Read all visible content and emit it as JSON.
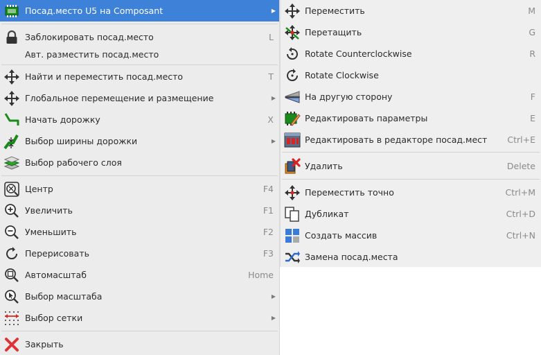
{
  "left_menu": {
    "items": [
      {
        "label": "Посад.место U5 на Composant",
        "shortcut": "",
        "submenu": true,
        "highlighted": true,
        "icon": "footprint-icon"
      },
      {
        "label": "Заблокировать посад.место",
        "shortcut": "L",
        "icon": "lock-icon"
      },
      {
        "label": "Авт. разместить посад.место",
        "shortcut": "",
        "icon": ""
      },
      {
        "label": "Найти и переместить посад.место",
        "shortcut": "T",
        "icon": "move-arrows-icon"
      },
      {
        "label": "Глобальное перемещение и размещение",
        "shortcut": "",
        "submenu": true,
        "icon": "move-arrows-icon"
      },
      {
        "label": "Начать дорожку",
        "shortcut": "X",
        "icon": "track-icon"
      },
      {
        "label": "Выбор ширины дорожки",
        "shortcut": "",
        "submenu": true,
        "icon": "track-width-icon"
      },
      {
        "label": "Выбор рабочего слоя",
        "shortcut": "",
        "icon": "layers-icon"
      },
      {
        "label": "Центр",
        "shortcut": "F4",
        "icon": "zoom-center-icon"
      },
      {
        "label": "Увеличить",
        "shortcut": "F1",
        "icon": "zoom-in-icon"
      },
      {
        "label": "Уменьшить",
        "shortcut": "F2",
        "icon": "zoom-out-icon"
      },
      {
        "label": "Перерисовать",
        "shortcut": "F3",
        "icon": "redraw-icon"
      },
      {
        "label": "Автомасштаб",
        "shortcut": "Home",
        "icon": "zoom-fit-icon"
      },
      {
        "label": "Выбор масштаба",
        "shortcut": "",
        "submenu": true,
        "icon": "zoom-select-icon"
      },
      {
        "label": "Выбор сетки",
        "shortcut": "",
        "submenu": true,
        "icon": "grid-icon"
      },
      {
        "label": "Закрыть",
        "shortcut": "",
        "icon": "close-icon"
      }
    ]
  },
  "right_menu": {
    "items": [
      {
        "label": "Переместить",
        "shortcut": "M",
        "icon": "move-arrows-icon"
      },
      {
        "label": "Перетащить",
        "shortcut": "G",
        "icon": "drag-icon"
      },
      {
        "label": "Rotate Counterclockwise",
        "shortcut": "R",
        "icon": "rotate-ccw-icon"
      },
      {
        "label": "Rotate Clockwise",
        "shortcut": "",
        "icon": "rotate-cw-icon"
      },
      {
        "label": "На другую сторону",
        "shortcut": "F",
        "icon": "flip-icon"
      },
      {
        "label": "Редактировать параметры",
        "shortcut": "E",
        "icon": "edit-properties-icon"
      },
      {
        "label": "Редактировать в редакторе посад.мест",
        "shortcut": "Ctrl+E",
        "icon": "footprint-editor-icon"
      },
      {
        "label": "Удалить",
        "shortcut": "Delete",
        "icon": "delete-icon"
      },
      {
        "label": "Переместить точно",
        "shortcut": "Ctrl+M",
        "icon": "move-exact-icon"
      },
      {
        "label": "Дубликат",
        "shortcut": "Ctrl+D",
        "icon": "duplicate-icon"
      },
      {
        "label": "Создать массив",
        "shortcut": "Ctrl+N",
        "icon": "array-icon"
      },
      {
        "label": "Замена посад.места",
        "shortcut": "",
        "icon": "exchange-icon"
      }
    ]
  },
  "colors": {
    "highlight": "#3d82d8",
    "menu_bg": "#ececec",
    "shortcut": "#8a8a8a"
  }
}
